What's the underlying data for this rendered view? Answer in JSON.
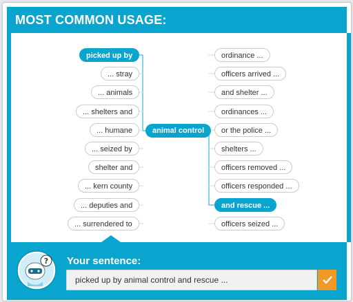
{
  "title": "MOST COMMON USAGE:",
  "center": "animal control",
  "left": [
    "picked up by",
    "... stray",
    "... animals",
    "... shelters and",
    "... humane",
    "... seized by",
    "shelter and",
    "... kern county",
    "... deputies and",
    "... surrendered to"
  ],
  "right": [
    "ordinance ...",
    "officers arrived ...",
    "and shelter ...",
    "ordinances ...",
    "or the police ...",
    "shelters ...",
    "officers removed ...",
    "officers responded ...",
    "and rescue ...",
    "officers seized ..."
  ],
  "selected_left": 0,
  "selected_right": 8,
  "sentence_label": "Your sentence:",
  "sentence_value": "picked up by animal control and rescue ...",
  "icons": {
    "submit": "check-icon",
    "mascot": "help-mascot-icon"
  },
  "colors": {
    "accent": "#0aa5cf",
    "submit": "#f39a26"
  }
}
